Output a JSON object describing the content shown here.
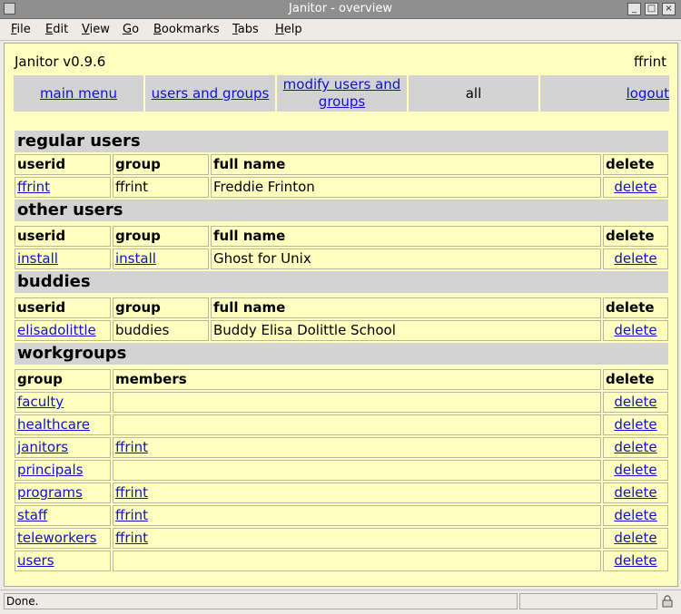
{
  "window": {
    "title": "Janitor - overview",
    "controls": [
      "_",
      "□",
      "×"
    ]
  },
  "menu": [
    {
      "label": "File",
      "mnemonic": "F",
      "rest": "ile"
    },
    {
      "label": "Edit",
      "mnemonic": "E",
      "rest": "dit"
    },
    {
      "label": "View",
      "mnemonic": "V",
      "rest": "iew"
    },
    {
      "label": "Go",
      "mnemonic": "G",
      "rest": "o"
    },
    {
      "label": "Bookmarks",
      "mnemonic": "B",
      "rest": "ookmarks"
    },
    {
      "label": "Tabs",
      "mnemonic": "T",
      "rest": "abs"
    },
    {
      "label": "Help",
      "mnemonic": "H",
      "rest": "elp"
    }
  ],
  "header": {
    "app": "Janitor v0.9.6",
    "user": "ffrint"
  },
  "nav": {
    "main_menu": "main menu",
    "users_groups": "users and groups",
    "modify_line1": "modify users and",
    "modify_line2": "groups",
    "all": "all",
    "logout": "logout"
  },
  "regular_users": {
    "title": "regular users",
    "headers": [
      "userid",
      "group",
      "full name",
      "delete"
    ],
    "rows": [
      {
        "userid": "ffrint",
        "group": "ffrint",
        "full_name": "Freddie Frinton",
        "delete": "delete"
      }
    ]
  },
  "other_users": {
    "title": "other users",
    "headers": [
      "userid",
      "group",
      "full name",
      "delete"
    ],
    "rows": [
      {
        "userid": "install",
        "group": "install",
        "full_name": "Ghost for Unix",
        "delete": "delete"
      }
    ]
  },
  "buddies": {
    "title": "buddies",
    "headers": [
      "userid",
      "group",
      "full name",
      "delete"
    ],
    "rows": [
      {
        "userid": "elisadolittle",
        "group": "buddies",
        "full_name": "Buddy Elisa Dolittle School",
        "delete": "delete"
      }
    ]
  },
  "workgroups": {
    "title": "workgroups",
    "headers": [
      "group",
      "members",
      "delete"
    ],
    "rows": [
      {
        "group": "faculty",
        "members": "",
        "delete": "delete"
      },
      {
        "group": "healthcare",
        "members": "",
        "delete": "delete"
      },
      {
        "group": "janitors",
        "members": "ffrint",
        "delete": "delete"
      },
      {
        "group": "principals",
        "members": "",
        "delete": "delete"
      },
      {
        "group": "programs",
        "members": "ffrint",
        "delete": "delete"
      },
      {
        "group": "staff",
        "members": "ffrint",
        "delete": "delete"
      },
      {
        "group": "teleworkers",
        "members": "ffrint",
        "delete": "delete"
      },
      {
        "group": "users",
        "members": "",
        "delete": "delete"
      }
    ]
  },
  "status": {
    "text": "Done."
  }
}
